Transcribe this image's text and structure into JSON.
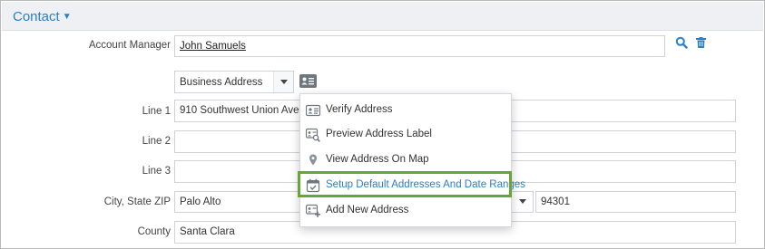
{
  "section": {
    "title": "Contact"
  },
  "account_manager": {
    "label": "Account Manager",
    "value": "John Samuels"
  },
  "address_type": {
    "selected": "Business Address"
  },
  "line1": {
    "label": "Line 1",
    "value": "910 Southwest Union Avenue"
  },
  "line2": {
    "label": "Line 2",
    "value": ""
  },
  "line3": {
    "label": "Line 3",
    "value": ""
  },
  "city_state_zip": {
    "label": "City, State ZIP",
    "city": "Palo Alto",
    "zip": "94301"
  },
  "county": {
    "label": "County",
    "value": "Santa Clara"
  },
  "menu": {
    "items": [
      {
        "label": "Verify Address",
        "icon": "address-card-icon"
      },
      {
        "label": "Preview Address Label",
        "icon": "address-card-search-icon"
      },
      {
        "label": "View Address On Map",
        "icon": "map-pin-icon"
      },
      {
        "label": "Setup Default Addresses And Date Ranges",
        "icon": "calendar-check-icon",
        "highlighted": true
      },
      {
        "label": "Add New Address",
        "icon": "address-card-plus-icon"
      }
    ]
  },
  "colors": {
    "accent": "#2a7fc7",
    "highlight": "#6aa437",
    "icon_gray": "#6e7780"
  }
}
